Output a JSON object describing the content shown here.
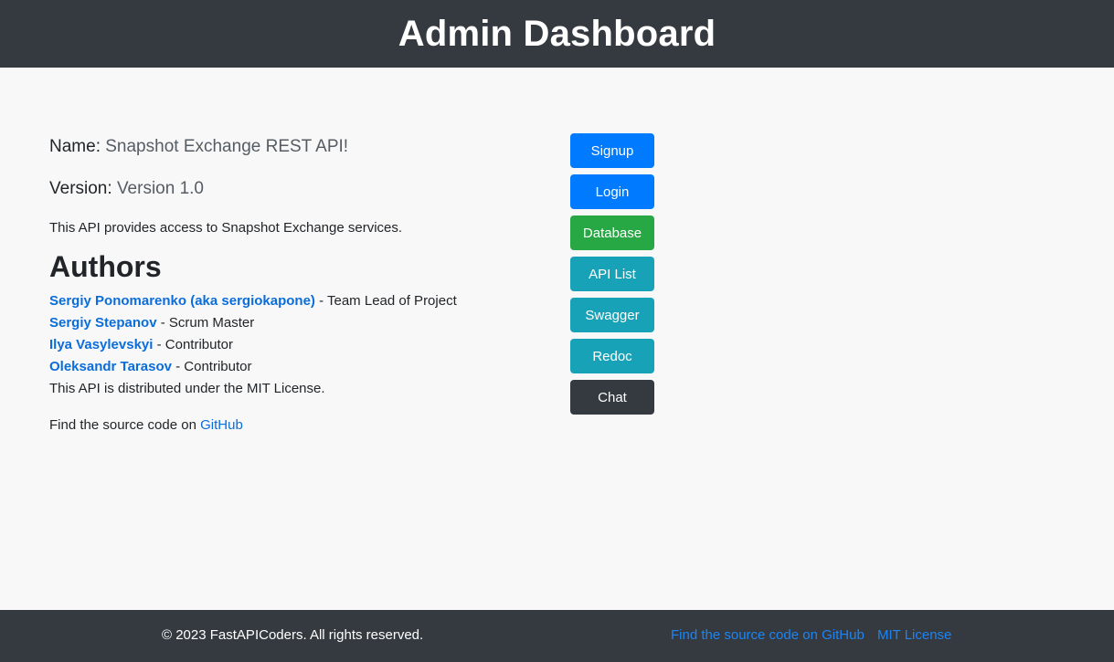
{
  "header": {
    "title": "Admin Dashboard"
  },
  "info": {
    "name_label": "Name",
    "name_value": "Snapshot Exchange REST API!",
    "version_label": "Version",
    "version_value": "Version 1.0",
    "description": "This API provides access to Snapshot Exchange services.",
    "authors_heading": "Authors",
    "authors": [
      {
        "name": "Sergiy Ponomarenko (aka sergiokapone)",
        "role": "- Team Lead of Project"
      },
      {
        "name": "Sergiy Stepanov",
        "role": "- Scrum Master"
      },
      {
        "name": "Ilya Vasylevskyi",
        "role": "- Contributor"
      },
      {
        "name": "Oleksandr Tarasov",
        "role": "- Contributor"
      }
    ],
    "license": "This API is distributed under the MIT License.",
    "source_text": "Find the source code on",
    "source_link": "GitHub"
  },
  "buttons": {
    "signup": "Signup",
    "login": "Login",
    "database": "Database",
    "api_list": "API List",
    "swagger": "Swagger",
    "redoc": "Redoc",
    "chat": "Chat"
  },
  "footer": {
    "copyright": "© 2023 FastAPICoders. All rights reserved.",
    "github_link": "Find the source code on GitHub",
    "license_link": "MIT License"
  },
  "colors": {
    "header_bg": "#343a40",
    "primary": "#007bff",
    "success": "#28a745",
    "info": "#17a2b8",
    "dark": "#343a40",
    "link": "#0a6ddb"
  }
}
